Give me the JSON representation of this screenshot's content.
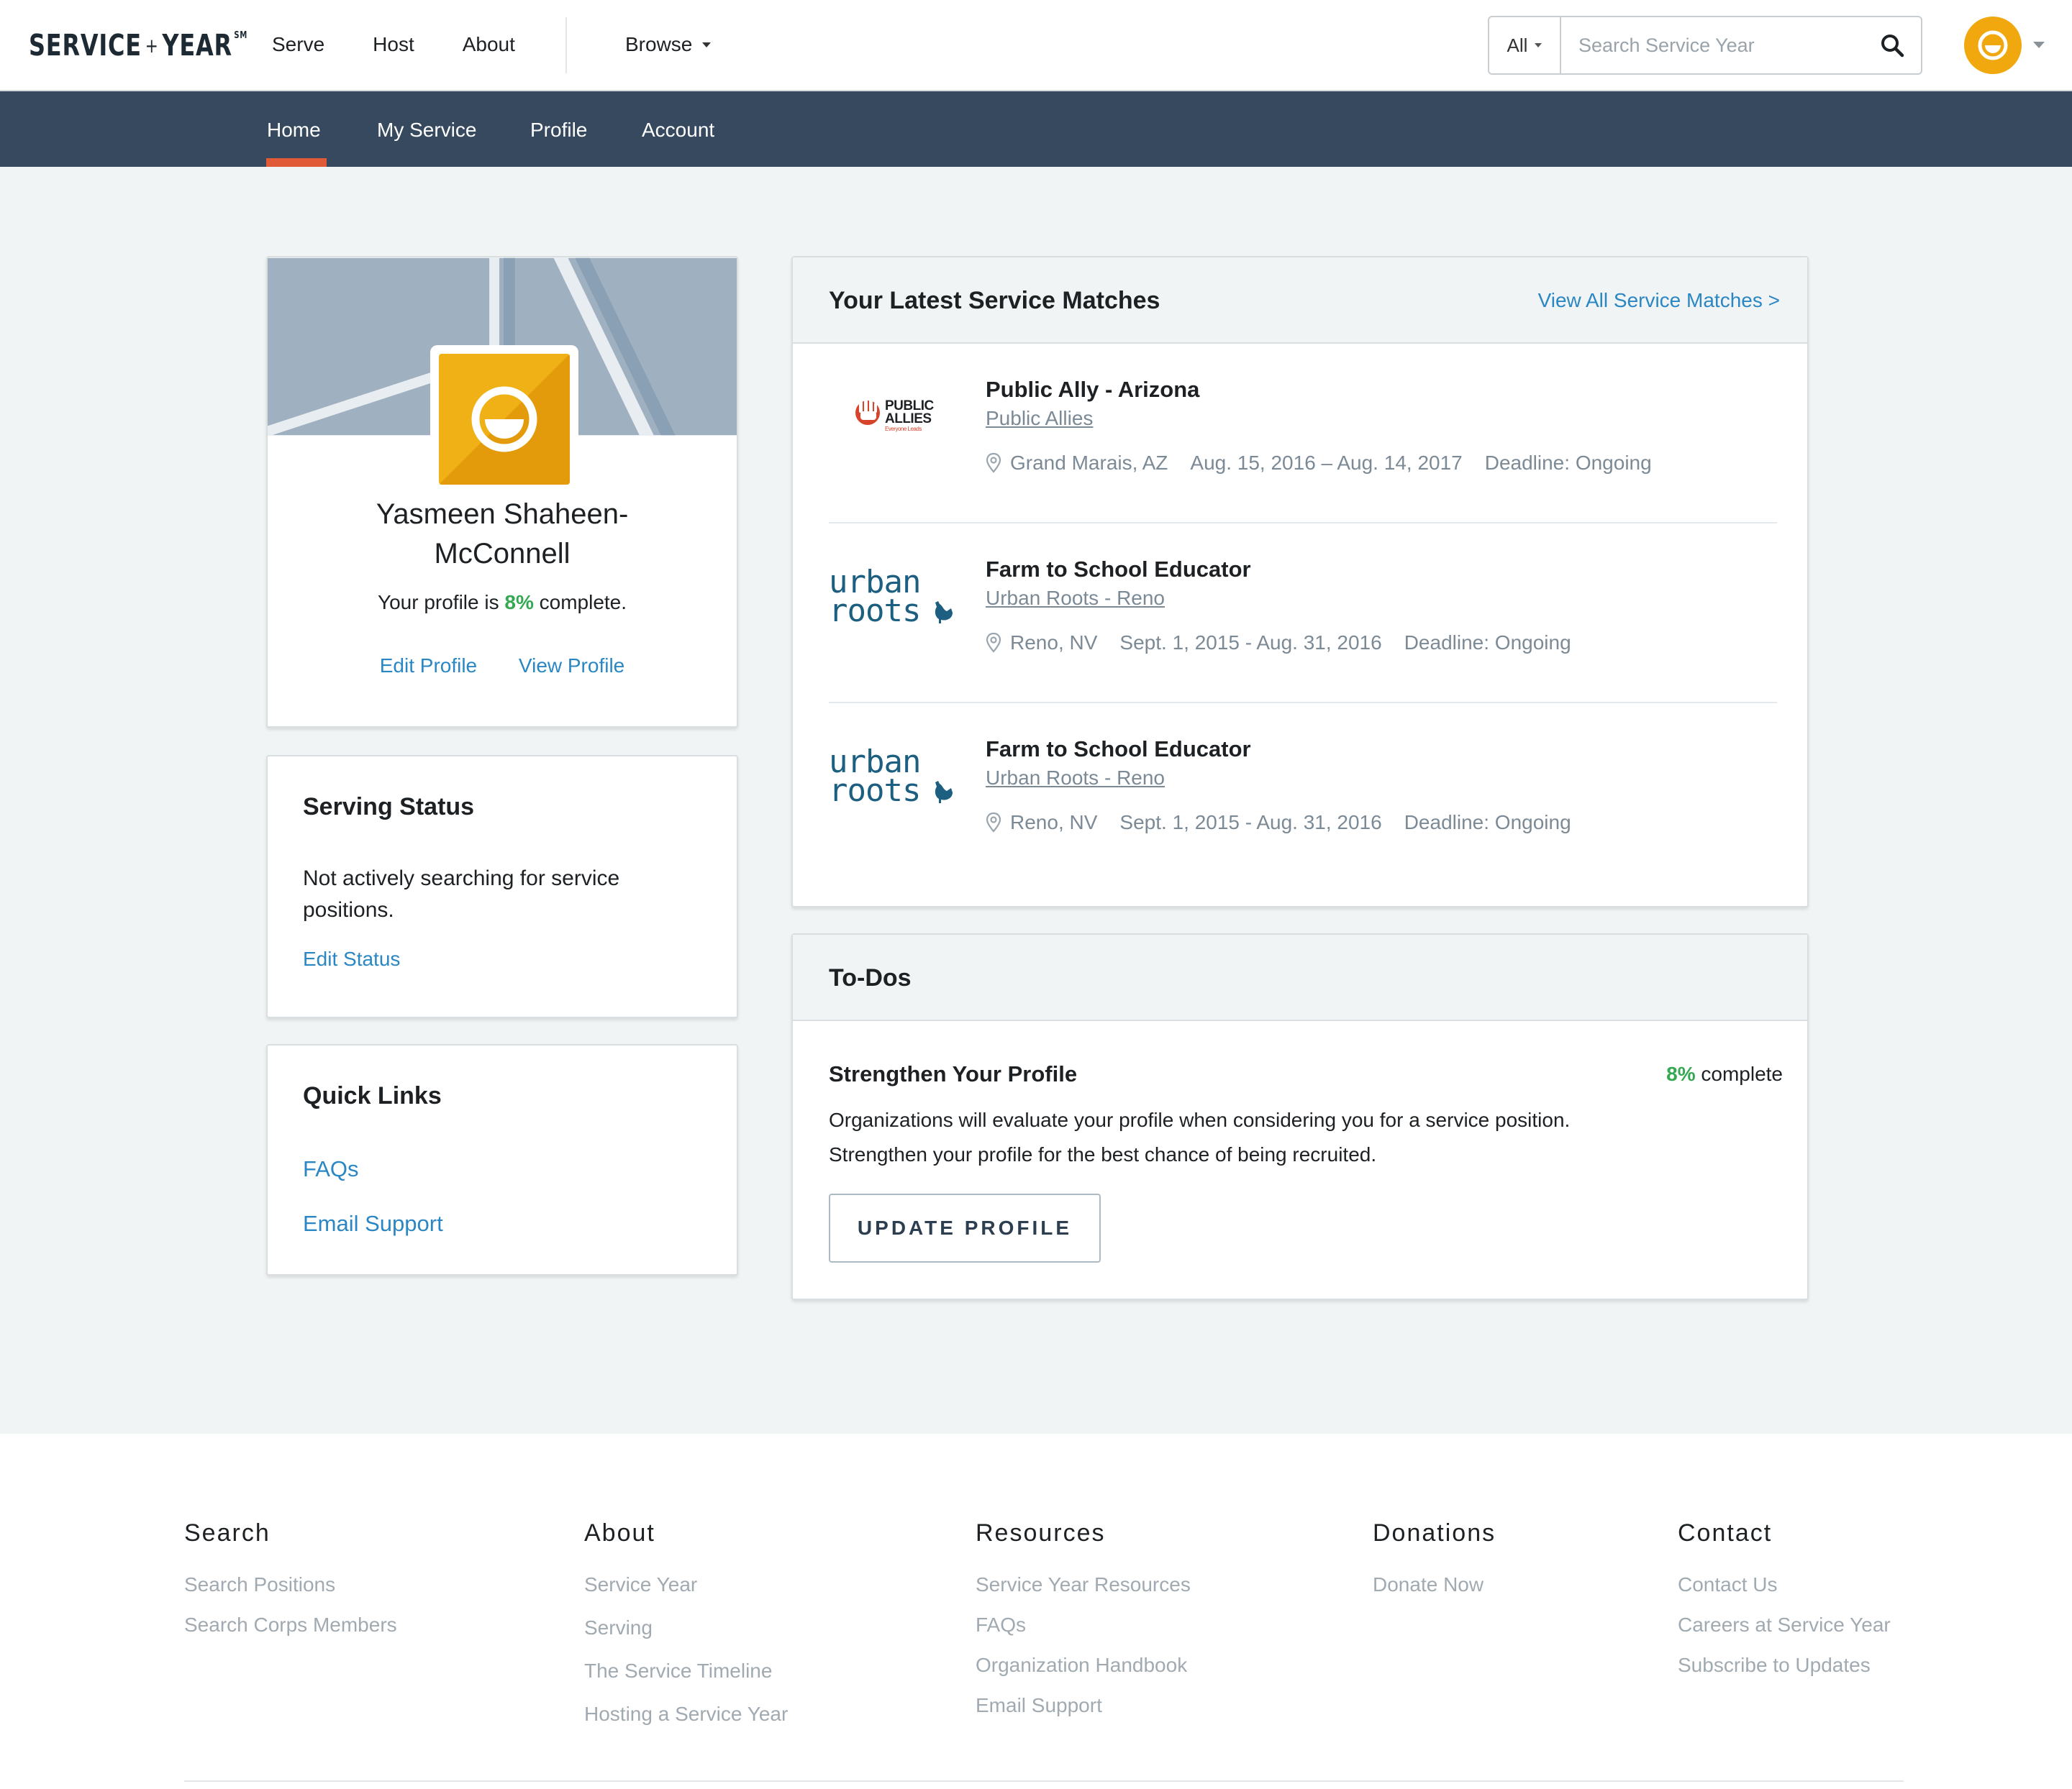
{
  "header": {
    "brand_left": "SERVICE",
    "brand_plus": "+",
    "brand_right": "YEAR",
    "brand_mark": "SM",
    "nav": [
      "Serve",
      "Host",
      "About"
    ],
    "browse": "Browse",
    "search_scope": "All",
    "search_placeholder": "Search Service Year",
    "search_icon": "search-icon",
    "avatar_icon": "smiley-icon"
  },
  "subnav": {
    "tabs": [
      "Home",
      "My Service",
      "Profile",
      "Account"
    ],
    "active": "Home",
    "accent": "#e15a37"
  },
  "profile": {
    "name_line1": "Yasmeen Shaheen-",
    "name_line2": "McConnell",
    "complete_prefix": "Your profile is ",
    "complete_percent": "8%",
    "complete_suffix": " complete.",
    "complete_fraction": 0.08,
    "edit": "Edit Profile",
    "view": "View Profile"
  },
  "serving_status": {
    "heading": "Serving Status",
    "text": "Not actively searching for service positions.",
    "edit": "Edit Status"
  },
  "quick_links": {
    "heading": "Quick Links",
    "links": [
      "FAQs",
      "Email Support"
    ]
  },
  "matches": {
    "heading": "Your Latest Service Matches",
    "view_all": "View All Service Matches >",
    "items": [
      {
        "title": "Public Ally - Arizona",
        "org": "Public Allies",
        "location": "Grand Marais, AZ",
        "dates": "Aug. 15, 2016 – Aug. 14, 2017",
        "deadline": "Deadline: Ongoing",
        "logo_line1": "PUBLIC",
        "logo_line2": "ALLIES",
        "logo_tag": "Everyone Leads"
      },
      {
        "title": "Farm to School Educator",
        "org": "Urban Roots - Reno",
        "location": "Reno, NV",
        "dates": "Sept. 1, 2015 - Aug. 31, 2016",
        "deadline": "Deadline: Ongoing",
        "logo_line1": "urban",
        "logo_line2": "roots"
      },
      {
        "title": "Farm to School Educator",
        "org": "Urban Roots - Reno",
        "location": "Reno, NV",
        "dates": "Sept. 1, 2015 - Aug. 31, 2016",
        "deadline": "Deadline: Ongoing",
        "logo_line1": "urban",
        "logo_line2": "roots"
      }
    ]
  },
  "todos": {
    "heading": "To-Dos",
    "item_title": "Strengthen Your Profile",
    "percent": "8%",
    "percent_suffix": " complete",
    "desc_line1": "Organizations will evaluate your profile when considering you for a service position.",
    "desc_line2": "Strengthen your profile for the best chance of being recruited.",
    "button": "UPDATE PROFILE"
  },
  "footer": {
    "columns": [
      {
        "heading": "Search",
        "links": [
          "Search Positions",
          "Search Corps Members"
        ]
      },
      {
        "heading": "About",
        "links": [
          "Service Year",
          "Serving",
          "The Service Timeline",
          "Hosting a Service Year"
        ]
      },
      {
        "heading": "Resources",
        "links": [
          "Service Year Resources",
          "FAQs",
          "Organization Handbook",
          "Email Support"
        ]
      },
      {
        "heading": "Donations",
        "links": [
          "Donate Now"
        ]
      },
      {
        "heading": "Contact",
        "links": [
          "Contact Us",
          "Careers at Service Year",
          "Subscribe to Updates"
        ]
      }
    ]
  },
  "colors": {
    "link": "#2b87c3",
    "subnav_bg": "#36495e",
    "page_bg": "#f1f4f5",
    "complete_green": "#36a852",
    "avatar_yellow": "#f1a80f"
  }
}
